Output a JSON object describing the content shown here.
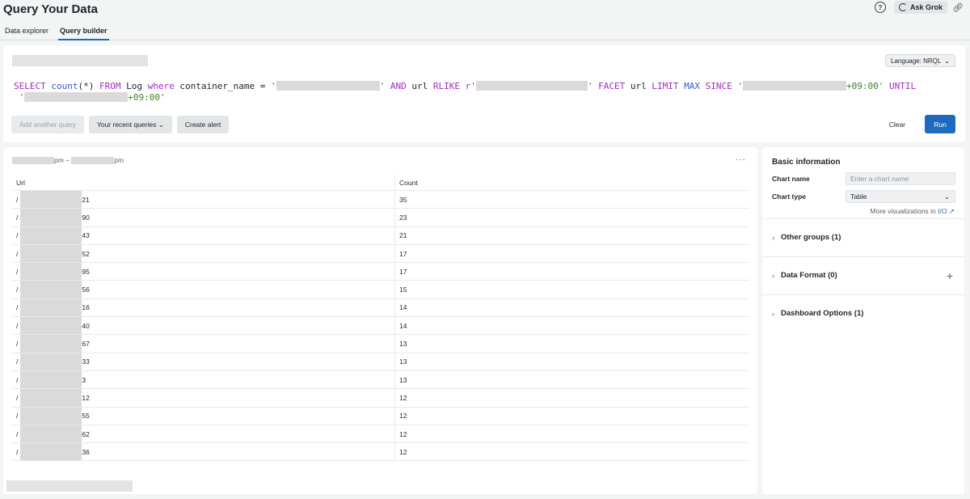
{
  "header": {
    "title": "Query Your Data",
    "ask_grok_label": "Ask Grok",
    "help_glyph": "?",
    "tabs": [
      {
        "label": "Data explorer",
        "active": false
      },
      {
        "label": "Query builder",
        "active": true
      }
    ]
  },
  "query": {
    "language_label": "Language: NRQL",
    "nrql": {
      "select": "SELECT",
      "count_fn": "count",
      "count_arg": "(*)",
      "from": "FROM",
      "table": "Log",
      "where": "where",
      "field1": "container_name",
      "eq": "=",
      "quote": "'",
      "and": "AND",
      "field2": "url",
      "rlike": "RLIKE",
      "rlike_prefix": "r'",
      "facet": "FACET",
      "facet_field": "url",
      "limit": "LIMIT",
      "max": "MAX",
      "since": "SINCE",
      "tz1": "+09:00'",
      "until": "UNTIL",
      "tz2": "+09:00'"
    },
    "buttons": {
      "add_another": "Add another query",
      "recent": "Your recent queries",
      "create_alert": "Create alert",
      "clear": "Clear",
      "run": "Run"
    }
  },
  "results": {
    "time_start_suffix": "pm –",
    "time_end_suffix": "pm",
    "more_menu": "···",
    "columns": {
      "url": "Url",
      "count": "Count"
    },
    "rows": [
      {
        "url_prefix": "/",
        "url_suffix": "21",
        "count": "35"
      },
      {
        "url_prefix": "/",
        "url_suffix": "90",
        "count": "23"
      },
      {
        "url_prefix": "/",
        "url_suffix": "43",
        "count": "21"
      },
      {
        "url_prefix": "/",
        "url_suffix": "52",
        "count": "17"
      },
      {
        "url_prefix": "/",
        "url_suffix": "95",
        "count": "17"
      },
      {
        "url_prefix": "/",
        "url_suffix": "56",
        "count": "15"
      },
      {
        "url_prefix": "/",
        "url_suffix": "16",
        "count": "14"
      },
      {
        "url_prefix": "/",
        "url_suffix": "40",
        "count": "14"
      },
      {
        "url_prefix": "/",
        "url_suffix": "67",
        "count": "13"
      },
      {
        "url_prefix": "/",
        "url_suffix": "33",
        "count": "13"
      },
      {
        "url_prefix": "/",
        "url_suffix": "3",
        "count": "13"
      },
      {
        "url_prefix": "/",
        "url_suffix": "12",
        "count": "12"
      },
      {
        "url_prefix": "/",
        "url_suffix": "55",
        "count": "12"
      },
      {
        "url_prefix": "/",
        "url_suffix": "62",
        "count": "12"
      },
      {
        "url_prefix": "/",
        "url_suffix": "36",
        "count": "12"
      }
    ]
  },
  "settings": {
    "section_title": "Basic information",
    "chart_name_label": "Chart name",
    "chart_name_placeholder": "Enter a chart name",
    "chart_type_label": "Chart type",
    "chart_type_value": "Table",
    "more_viz_text": "More visualizations in",
    "more_viz_link": "I/O",
    "groups": [
      {
        "label": "Other groups (1)",
        "has_plus": false
      },
      {
        "label": "Data Format (0)",
        "has_plus": true
      },
      {
        "label": "Dashboard Options (1)",
        "has_plus": false
      }
    ]
  },
  "colors": {
    "accent": "#1d6bbf",
    "keyword": "#a12cbf",
    "string": "#3f7f26",
    "function": "#3b59c8"
  }
}
